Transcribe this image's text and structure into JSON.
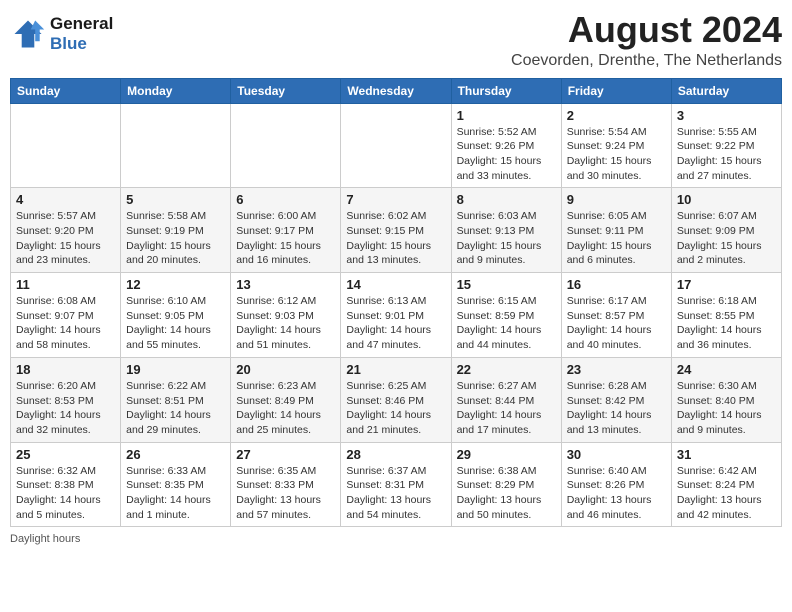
{
  "logo": {
    "line1": "General",
    "line2": "Blue"
  },
  "title": "August 2024",
  "location": "Coevorden, Drenthe, The Netherlands",
  "days_of_week": [
    "Sunday",
    "Monday",
    "Tuesday",
    "Wednesday",
    "Thursday",
    "Friday",
    "Saturday"
  ],
  "weeks": [
    [
      {
        "day": "",
        "info": ""
      },
      {
        "day": "",
        "info": ""
      },
      {
        "day": "",
        "info": ""
      },
      {
        "day": "",
        "info": ""
      },
      {
        "day": "1",
        "info": "Sunrise: 5:52 AM\nSunset: 9:26 PM\nDaylight: 15 hours\nand 33 minutes."
      },
      {
        "day": "2",
        "info": "Sunrise: 5:54 AM\nSunset: 9:24 PM\nDaylight: 15 hours\nand 30 minutes."
      },
      {
        "day": "3",
        "info": "Sunrise: 5:55 AM\nSunset: 9:22 PM\nDaylight: 15 hours\nand 27 minutes."
      }
    ],
    [
      {
        "day": "4",
        "info": "Sunrise: 5:57 AM\nSunset: 9:20 PM\nDaylight: 15 hours\nand 23 minutes."
      },
      {
        "day": "5",
        "info": "Sunrise: 5:58 AM\nSunset: 9:19 PM\nDaylight: 15 hours\nand 20 minutes."
      },
      {
        "day": "6",
        "info": "Sunrise: 6:00 AM\nSunset: 9:17 PM\nDaylight: 15 hours\nand 16 minutes."
      },
      {
        "day": "7",
        "info": "Sunrise: 6:02 AM\nSunset: 9:15 PM\nDaylight: 15 hours\nand 13 minutes."
      },
      {
        "day": "8",
        "info": "Sunrise: 6:03 AM\nSunset: 9:13 PM\nDaylight: 15 hours\nand 9 minutes."
      },
      {
        "day": "9",
        "info": "Sunrise: 6:05 AM\nSunset: 9:11 PM\nDaylight: 15 hours\nand 6 minutes."
      },
      {
        "day": "10",
        "info": "Sunrise: 6:07 AM\nSunset: 9:09 PM\nDaylight: 15 hours\nand 2 minutes."
      }
    ],
    [
      {
        "day": "11",
        "info": "Sunrise: 6:08 AM\nSunset: 9:07 PM\nDaylight: 14 hours\nand 58 minutes."
      },
      {
        "day": "12",
        "info": "Sunrise: 6:10 AM\nSunset: 9:05 PM\nDaylight: 14 hours\nand 55 minutes."
      },
      {
        "day": "13",
        "info": "Sunrise: 6:12 AM\nSunset: 9:03 PM\nDaylight: 14 hours\nand 51 minutes."
      },
      {
        "day": "14",
        "info": "Sunrise: 6:13 AM\nSunset: 9:01 PM\nDaylight: 14 hours\nand 47 minutes."
      },
      {
        "day": "15",
        "info": "Sunrise: 6:15 AM\nSunset: 8:59 PM\nDaylight: 14 hours\nand 44 minutes."
      },
      {
        "day": "16",
        "info": "Sunrise: 6:17 AM\nSunset: 8:57 PM\nDaylight: 14 hours\nand 40 minutes."
      },
      {
        "day": "17",
        "info": "Sunrise: 6:18 AM\nSunset: 8:55 PM\nDaylight: 14 hours\nand 36 minutes."
      }
    ],
    [
      {
        "day": "18",
        "info": "Sunrise: 6:20 AM\nSunset: 8:53 PM\nDaylight: 14 hours\nand 32 minutes."
      },
      {
        "day": "19",
        "info": "Sunrise: 6:22 AM\nSunset: 8:51 PM\nDaylight: 14 hours\nand 29 minutes."
      },
      {
        "day": "20",
        "info": "Sunrise: 6:23 AM\nSunset: 8:49 PM\nDaylight: 14 hours\nand 25 minutes."
      },
      {
        "day": "21",
        "info": "Sunrise: 6:25 AM\nSunset: 8:46 PM\nDaylight: 14 hours\nand 21 minutes."
      },
      {
        "day": "22",
        "info": "Sunrise: 6:27 AM\nSunset: 8:44 PM\nDaylight: 14 hours\nand 17 minutes."
      },
      {
        "day": "23",
        "info": "Sunrise: 6:28 AM\nSunset: 8:42 PM\nDaylight: 14 hours\nand 13 minutes."
      },
      {
        "day": "24",
        "info": "Sunrise: 6:30 AM\nSunset: 8:40 PM\nDaylight: 14 hours\nand 9 minutes."
      }
    ],
    [
      {
        "day": "25",
        "info": "Sunrise: 6:32 AM\nSunset: 8:38 PM\nDaylight: 14 hours\nand 5 minutes."
      },
      {
        "day": "26",
        "info": "Sunrise: 6:33 AM\nSunset: 8:35 PM\nDaylight: 14 hours\nand 1 minute."
      },
      {
        "day": "27",
        "info": "Sunrise: 6:35 AM\nSunset: 8:33 PM\nDaylight: 13 hours\nand 57 minutes."
      },
      {
        "day": "28",
        "info": "Sunrise: 6:37 AM\nSunset: 8:31 PM\nDaylight: 13 hours\nand 54 minutes."
      },
      {
        "day": "29",
        "info": "Sunrise: 6:38 AM\nSunset: 8:29 PM\nDaylight: 13 hours\nand 50 minutes."
      },
      {
        "day": "30",
        "info": "Sunrise: 6:40 AM\nSunset: 8:26 PM\nDaylight: 13 hours\nand 46 minutes."
      },
      {
        "day": "31",
        "info": "Sunrise: 6:42 AM\nSunset: 8:24 PM\nDaylight: 13 hours\nand 42 minutes."
      }
    ]
  ],
  "footer": "Daylight hours"
}
